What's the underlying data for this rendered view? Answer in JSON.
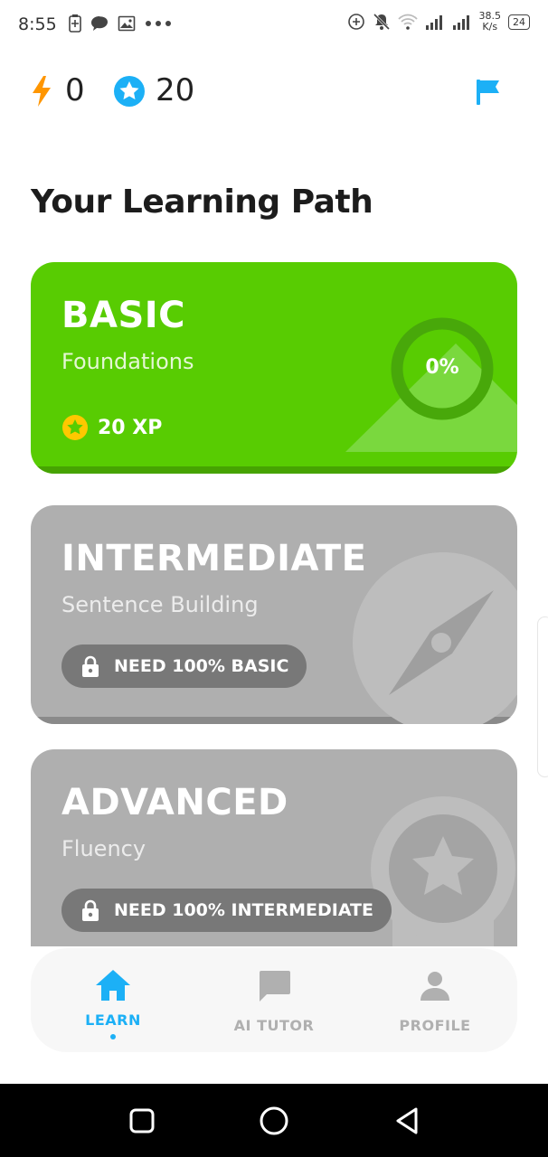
{
  "status_bar": {
    "time": "8:55",
    "network_speed_value": "38.5",
    "network_speed_unit": "K/s",
    "battery": "24",
    "icons": [
      "battery-saver-icon",
      "chat-bubble-icon",
      "image-icon",
      "more-dots-icon",
      "data-saver-icon",
      "mute-icon",
      "wifi-icon",
      "signal-icon",
      "signal-icon",
      "battery-icon"
    ]
  },
  "stats": {
    "streak_value": "0",
    "stars_value": "20",
    "streak_icon": "lightning-icon",
    "stars_icon": "star-badge-icon",
    "flag_icon": "flag-icon"
  },
  "page": {
    "title": "Your Learning Path"
  },
  "levels": [
    {
      "title": "BASIC",
      "subtitle": "Foundations",
      "xp": "20 XP",
      "progress_label": "0%",
      "progress": 0,
      "locked": false,
      "color": "#58cc02",
      "decoration_icon": "mountain-icon"
    },
    {
      "title": "INTERMEDIATE",
      "subtitle": "Sentence Building",
      "lock_text": "NEED 100% BASIC",
      "locked": true,
      "color": "#afafaf",
      "decoration_icon": "compass-icon"
    },
    {
      "title": "ADVANCED",
      "subtitle": "Fluency",
      "lock_text": "NEED 100% INTERMEDIATE",
      "locked": true,
      "color": "#afafaf",
      "decoration_icon": "medal-icon"
    }
  ],
  "bottom_nav": {
    "items": [
      {
        "label": "LEARN",
        "icon": "home-icon",
        "active": true
      },
      {
        "label": "AI TUTOR",
        "icon": "chat-icon",
        "active": false
      },
      {
        "label": "PROFILE",
        "icon": "person-icon",
        "active": false
      }
    ],
    "active_color": "#1cb0f6",
    "inactive_color": "#b0b0b0"
  },
  "system_nav": {
    "buttons": [
      "recents-icon",
      "home-circle-icon",
      "back-triangle-icon"
    ]
  }
}
